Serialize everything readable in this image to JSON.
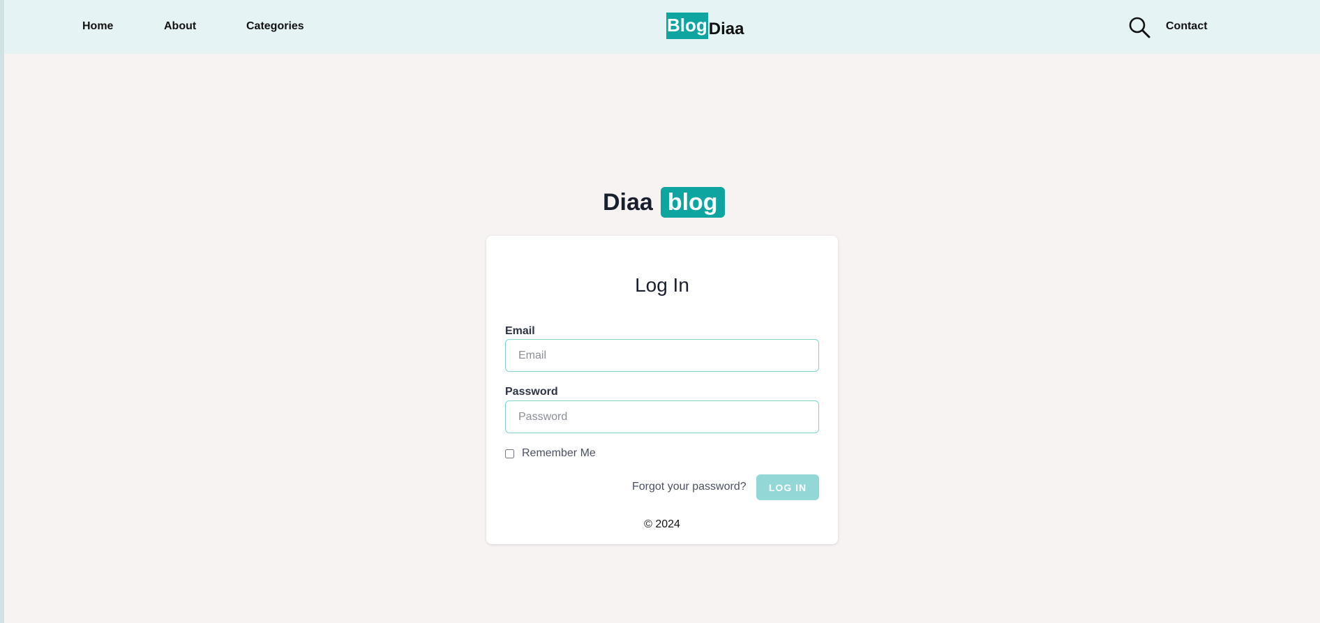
{
  "nav": {
    "home": "Home",
    "about": "About",
    "categories": "Categories",
    "contact": "Contact",
    "brand_box": "Blog",
    "brand_text": "Diaa",
    "search_icon": "search-icon"
  },
  "logo": {
    "word": "Diaa",
    "badge": "blog"
  },
  "login": {
    "title": "Log In",
    "email_label": "Email",
    "email_placeholder": "Email",
    "email_value": "",
    "password_label": "Password",
    "password_placeholder": "Password",
    "password_value": "",
    "remember_label": "Remember Me",
    "remember_checked": false,
    "forgot_link": "Forgot your password?",
    "submit_label": "LOG IN"
  },
  "footer": {
    "copyright": "© 2024"
  },
  "colors": {
    "accent": "#0ea5a0",
    "accent_light": "#93d8d6",
    "navbar_bg": "#e6f3f4",
    "page_bg": "#f7f3f3"
  }
}
